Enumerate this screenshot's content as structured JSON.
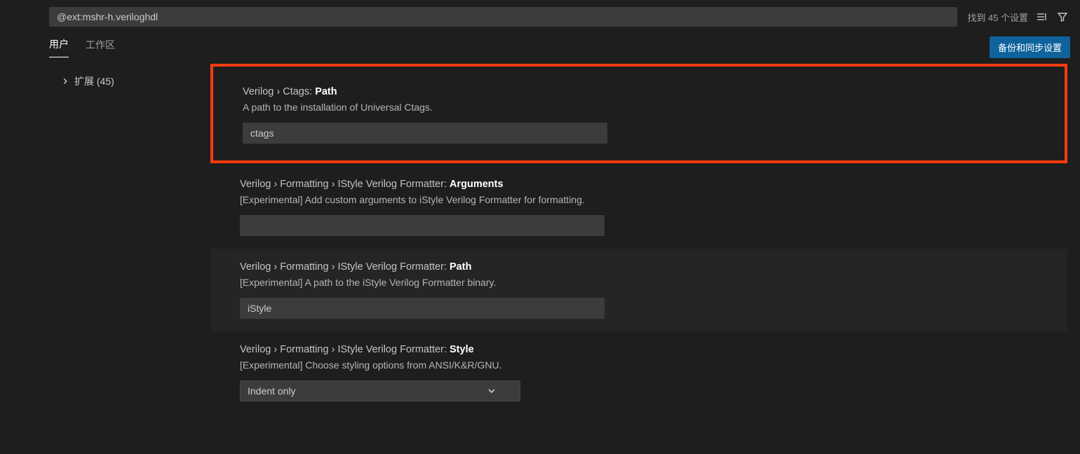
{
  "search": {
    "value": "@ext:mshr-h.veriloghdl",
    "count_text": "找到 45 个设置"
  },
  "tabs": {
    "user": "用户",
    "workspace": "工作区",
    "sync_button": "备份和同步设置"
  },
  "sidebar": {
    "extensions_label": "扩展 (45)"
  },
  "settings": [
    {
      "crumb1": "Verilog",
      "crumb2": "Ctags",
      "leaf": "Path",
      "description": "A path to the installation of Universal Ctags.",
      "value": "ctags",
      "type": "text",
      "framed": true,
      "modified": false
    },
    {
      "crumb1": "Verilog",
      "crumb2": "Formatting",
      "crumb3": "IStyle Verilog Formatter",
      "leaf": "Arguments",
      "description": "[Experimental] Add custom arguments to iStyle Verilog Formatter for formatting.",
      "value": "",
      "type": "text",
      "framed": false,
      "modified": false
    },
    {
      "crumb1": "Verilog",
      "crumb2": "Formatting",
      "crumb3": "IStyle Verilog Formatter",
      "leaf": "Path",
      "description": "[Experimental] A path to the iStyle Verilog Formatter binary.",
      "value": "iStyle",
      "type": "text",
      "framed": false,
      "modified": true
    },
    {
      "crumb1": "Verilog",
      "crumb2": "Formatting",
      "crumb3": "IStyle Verilog Formatter",
      "leaf": "Style",
      "description": "[Experimental] Choose styling options from ANSI/K&R/GNU.",
      "value": "Indent only",
      "type": "select",
      "framed": false,
      "modified": false
    }
  ]
}
